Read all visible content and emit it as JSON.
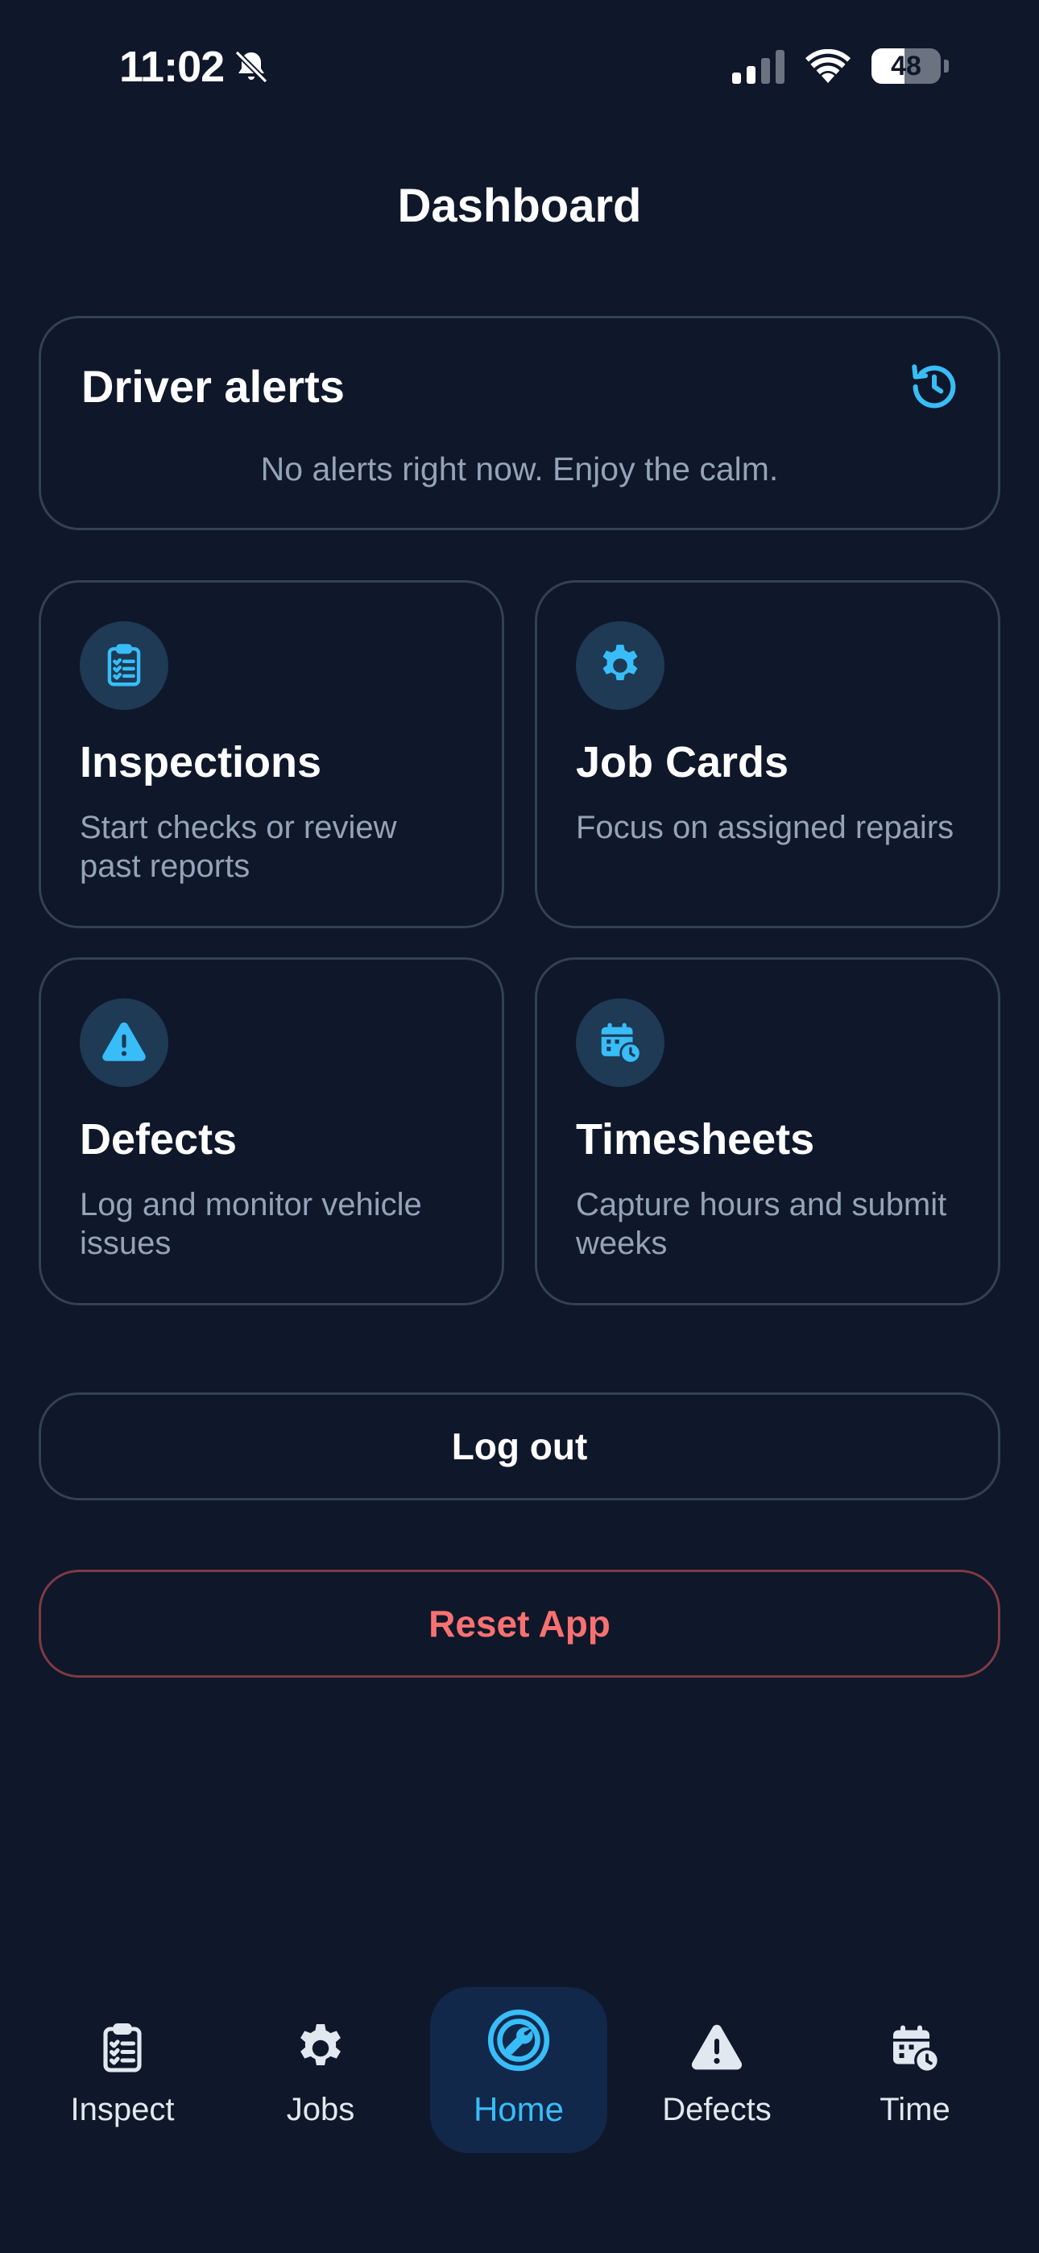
{
  "status": {
    "time": "11:02",
    "battery": "48",
    "battery_level": 0.48
  },
  "header": {
    "title": "Dashboard"
  },
  "alerts": {
    "title": "Driver alerts",
    "empty_text": "No alerts right now. Enjoy the calm."
  },
  "tiles": [
    {
      "title": "Inspections",
      "desc": "Start checks or review past reports",
      "icon": "clipboard-icon"
    },
    {
      "title": "Job Cards",
      "desc": "Focus on assigned repairs",
      "icon": "gear-icon"
    },
    {
      "title": "Defects",
      "desc": "Log and monitor vehicle issues",
      "icon": "warning-icon"
    },
    {
      "title": "Timesheets",
      "desc": "Capture hours and submit weeks",
      "icon": "calendar-clock-icon"
    }
  ],
  "actions": {
    "logout_label": "Log out",
    "reset_label": "Reset App"
  },
  "nav": {
    "items": [
      {
        "label": "Inspect",
        "icon": "clipboard-icon"
      },
      {
        "label": "Jobs",
        "icon": "gear-icon"
      },
      {
        "label": "Home",
        "icon": "home-wrench-icon",
        "active": true
      },
      {
        "label": "Defects",
        "icon": "warning-icon"
      },
      {
        "label": "Time",
        "icon": "calendar-clock-icon"
      }
    ]
  },
  "colors": {
    "background": "#0f172a",
    "accent": "#38bdf8",
    "card_border": "#334155",
    "danger": "#f87171",
    "muted_text": "#94a3b8"
  }
}
